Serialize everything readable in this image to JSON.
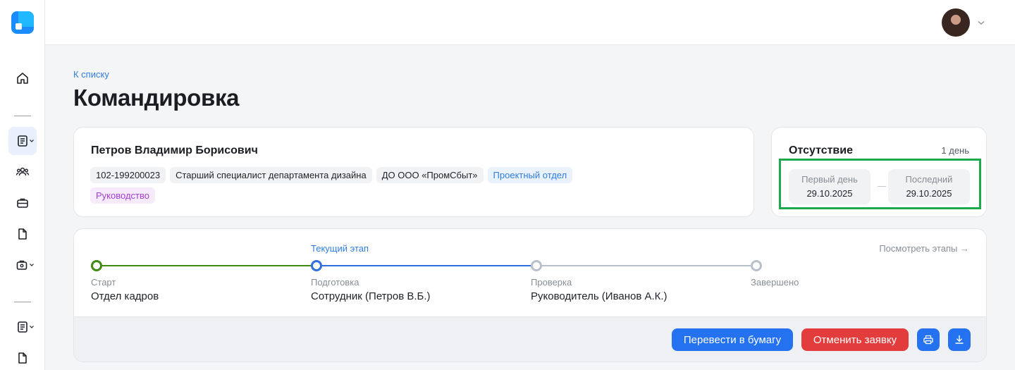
{
  "sidebar": {
    "items": [
      {
        "name": "home-icon"
      },
      {
        "name": "documents-icon"
      },
      {
        "name": "users-icon"
      },
      {
        "name": "briefcase-icon"
      },
      {
        "name": "file-icon"
      },
      {
        "name": "briefcase-settings-icon"
      },
      {
        "name": "list-icon"
      },
      {
        "name": "file-icon"
      }
    ]
  },
  "header": {
    "avatar": "user-avatar"
  },
  "page": {
    "back_link": "К списку",
    "title": "Командировка"
  },
  "person": {
    "name": "Петров Владимир Борисович",
    "chips": [
      "102-199200023",
      "Старший специалист департамента дизайна",
      "ДО ООО «ПромСбыт»"
    ],
    "department": "Проектный отдел",
    "role": "Руководство"
  },
  "absence": {
    "title": "Отсутствие",
    "duration": "1 день",
    "first_label": "Первый день",
    "first_value": "29.10.2025",
    "last_label": "Последний",
    "last_value": "29.10.2025"
  },
  "stages": {
    "current_label": "Текущий этап",
    "view_link": "Посмотреть этапы →",
    "items": [
      {
        "title": "Старт",
        "value": "Отдел кадров"
      },
      {
        "title": "Подготовка",
        "value": "Сотрудник (Петров В.Б.)"
      },
      {
        "title": "Проверка",
        "value": "Руководитель (Иванов А.К.)"
      },
      {
        "title": "Завершено",
        "value": ""
      }
    ],
    "colors": {
      "done": "#3e8a12",
      "current": "#2f6fe0",
      "pending": "#b8c0cc"
    }
  },
  "actions": {
    "convert_label": "Перевести в бумагу",
    "cancel_label": "Отменить заявку",
    "print_icon": "printer-icon",
    "download_icon": "download-icon"
  }
}
